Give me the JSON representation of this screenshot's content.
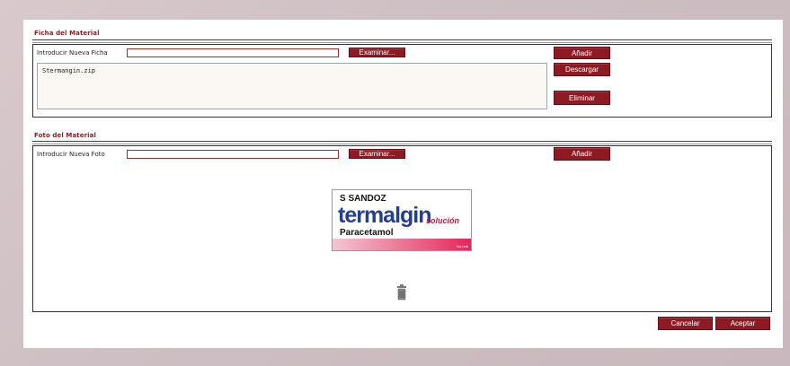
{
  "ficha": {
    "title": "Ficha del Material",
    "input_label": "Introducir Nueva Ficha",
    "browse_label": "Examinar...",
    "add_label": "Añadir",
    "download_label": "Descargar",
    "delete_label": "Eliminar",
    "files": [
      "Stermangin.zip"
    ]
  },
  "foto": {
    "title": "Foto del Material",
    "input_label": "Introducir Nueva Foto",
    "browse_label": "Examinar...",
    "add_label": "Añadir",
    "image": {
      "brand": "S SANDOZ",
      "name": "termalgin",
      "variant": "solución",
      "subtitle": "Paracetamol",
      "corner": "Via oral"
    },
    "trash_icon": "trash-icon"
  },
  "footer": {
    "cancel_label": "Cancelar",
    "accept_label": "Aceptar"
  },
  "colors": {
    "accent": "#8e1b24",
    "title": "#8b1a1f"
  }
}
